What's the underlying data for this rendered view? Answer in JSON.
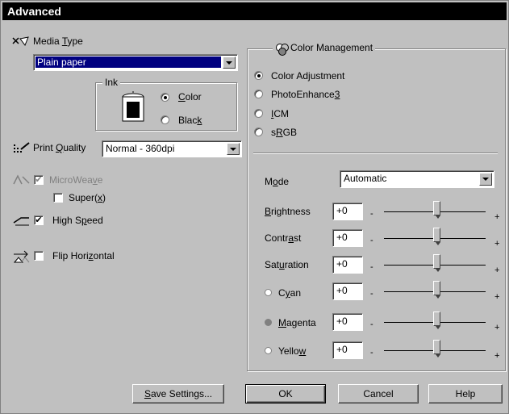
{
  "title": "Advanced",
  "media_type": {
    "label": "Media Type",
    "value": "Plain paper",
    "icon": "media-type-icon"
  },
  "ink": {
    "title": "Ink",
    "options": [
      {
        "label": "Color",
        "selected": true
      },
      {
        "label": "Black",
        "selected": false
      }
    ]
  },
  "print_quality": {
    "label": "Print Quality",
    "value": "Normal - 360dpi"
  },
  "microweave": {
    "label": "MicroWeave",
    "checked": true,
    "enabled": false
  },
  "super": {
    "label": "Super(x)",
    "checked": false
  },
  "high_speed": {
    "label": "High Speed",
    "checked": true
  },
  "flip_horizontal": {
    "label": "Flip Horizontal",
    "checked": false
  },
  "color_management": {
    "title": "Color Management",
    "options": [
      {
        "label": "Color Adjustment",
        "selected": true
      },
      {
        "label": "PhotoEnhance3",
        "selected": false
      },
      {
        "label": "ICM",
        "selected": false
      },
      {
        "label": "sRGB",
        "selected": false
      }
    ],
    "mode": {
      "label": "Mode",
      "value": "Automatic"
    },
    "sliders": [
      {
        "label": "Brightness",
        "value": "+0"
      },
      {
        "label": "Contrast",
        "value": "+0"
      },
      {
        "label": "Saturation",
        "value": "+0"
      },
      {
        "label": "Cyan",
        "value": "+0"
      },
      {
        "label": "Magenta",
        "value": "+0"
      },
      {
        "label": "Yellow",
        "value": "+0"
      }
    ],
    "minus": "-",
    "plus": "+"
  },
  "buttons": {
    "save_settings": "Save Settings...",
    "ok": "OK",
    "cancel": "Cancel",
    "help": "Help"
  }
}
